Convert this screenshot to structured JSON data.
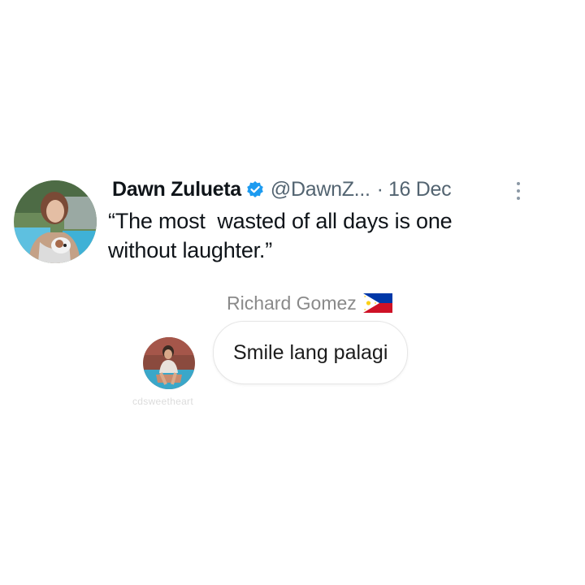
{
  "tweet": {
    "author_name": "Dawn Zulueta",
    "handle": "@DawnZ...",
    "separator": "·",
    "date": "16 Dec",
    "text_line1": "“The most  wasted of all days is one",
    "text_line2": "without laughter.”",
    "verified_color": "#1d9bf0",
    "icons": {
      "verified": "verified-badge-icon",
      "more": "more-vert-icon"
    }
  },
  "reply": {
    "author_name": "Richard Gomez",
    "flag": "philippines-flag-icon",
    "message": "Smile lang palagi",
    "watermark": "cdsweetheart"
  },
  "colors": {
    "name_text": "#0f1419",
    "secondary_text": "#536471",
    "reply_name_text": "#8a8a8a"
  }
}
